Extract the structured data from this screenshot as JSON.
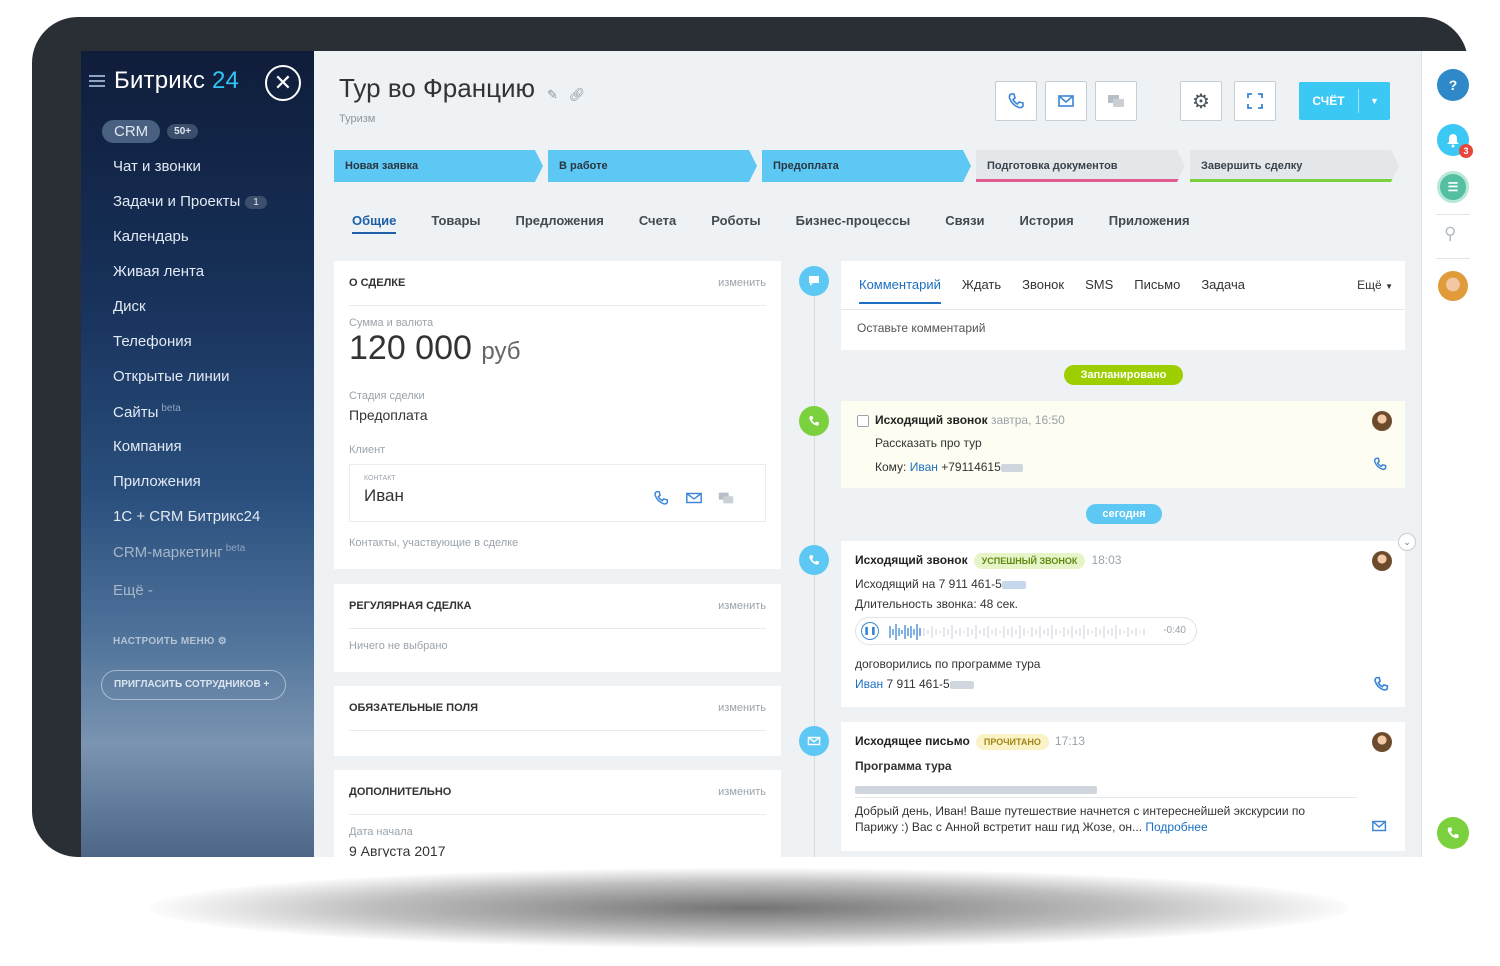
{
  "sidebar": {
    "logo_main": "Битрикс",
    "logo_num": "24",
    "crm_label": "CRM",
    "crm_count": "50+",
    "items": [
      {
        "label": "Чат и звонки"
      },
      {
        "label": "Задачи и Проекты",
        "count": "1"
      },
      {
        "label": "Календарь"
      },
      {
        "label": "Живая лента"
      },
      {
        "label": "Диск"
      },
      {
        "label": "Телефония"
      },
      {
        "label": "Открытые линии"
      },
      {
        "label": "Сайты",
        "sup": "beta"
      },
      {
        "label": "Компания"
      },
      {
        "label": "Приложения"
      },
      {
        "label": "1С + CRM Битрикс24"
      },
      {
        "label": "CRM-маркетинг",
        "sup": "beta"
      },
      {
        "label": "Ещё -"
      }
    ],
    "configure_menu": "НАСТРОИТЬ МЕНЮ",
    "invite": "ПРИГЛАСИТЬ СОТРУДНИКОВ"
  },
  "header": {
    "title": "Тур во Францию",
    "subtitle": "Туризм",
    "invoice_label": "СЧЁТ"
  },
  "stages": [
    {
      "label": "Новая заявка",
      "active": true
    },
    {
      "label": "В работе",
      "active": true
    },
    {
      "label": "Предоплата",
      "active": true
    },
    {
      "label": "Подготовка документов",
      "active": false,
      "color": "#e25b8f"
    },
    {
      "label": "Завершить сделку",
      "active": false,
      "color": "#7bd13d"
    }
  ],
  "tabs": [
    "Общие",
    "Товары",
    "Предложения",
    "Счета",
    "Роботы",
    "Бизнес-процессы",
    "Связи",
    "История",
    "Приложения"
  ],
  "deal": {
    "heading": "О СДЕЛКЕ",
    "edit": "изменить",
    "sum_label": "Сумма и валюта",
    "sum_value": "120 000",
    "currency": "руб",
    "stage_label": "Стадия сделки",
    "stage_value": "Предоплата",
    "client_label": "Клиент",
    "contact_small": "КОНТАКТ",
    "contact_name": "Иван",
    "contacts_note": "Контакты, участвующие в сделке"
  },
  "regular": {
    "heading": "РЕГУЛЯРНАЯ СДЕЛКА",
    "edit": "изменить",
    "value": "Ничего не выбрано"
  },
  "required": {
    "heading": "ОБЯЗАТЕЛЬНЫЕ ПОЛЯ",
    "edit": "изменить"
  },
  "additional": {
    "heading": "ДОПОЛНИТЕЛЬНО",
    "edit": "изменить",
    "start_label": "Дата начала",
    "start_value": "9 Августа 2017"
  },
  "timeline": {
    "tabs": [
      "Комментарий",
      "Ждать",
      "Звонок",
      "SMS",
      "Письмо",
      "Задача"
    ],
    "more": "Ещё",
    "comment_placeholder": "Оставьте комментарий",
    "planned_pill": "Запланировано",
    "today_pill": "сегодня",
    "planned_call": {
      "title": "Исходящий звонок",
      "when": "завтра, 16:50",
      "subject": "Рассказать про тур",
      "to_label": "Кому:",
      "to_name": "Иван",
      "to_phone": "+79114615"
    },
    "call": {
      "title": "Исходящий звонок",
      "tag": "УСПЕШНЫЙ ЗВОНОК",
      "time": "18:03",
      "outgoing": "Исходящий на 7 911 461-5",
      "duration": "Длительность звонка: 48 сек.",
      "remaining": "-0:40",
      "note": "договорились по программе тура",
      "contact_name": "Иван",
      "contact_phone": "7 911 461-5"
    },
    "email": {
      "title": "Исходящее письмо",
      "tag": "ПРОЧИТАНО",
      "time": "17:13",
      "subject": "Программа тура",
      "body1": "Добрый день, Иван!  Ваше путешествие начнется с интереснейшей экскурсии по",
      "body2": "Парижу :) Вас с Анной встретит наш гид Жозе, он...",
      "more": "Подробнее"
    }
  },
  "rightbar": {
    "help": "?",
    "notif_count": "3"
  },
  "colors": {
    "accent": "#3bc8f5",
    "link": "#1d6fc0",
    "green": "#7bd13d",
    "planned_bg": "#fdfdf1"
  }
}
